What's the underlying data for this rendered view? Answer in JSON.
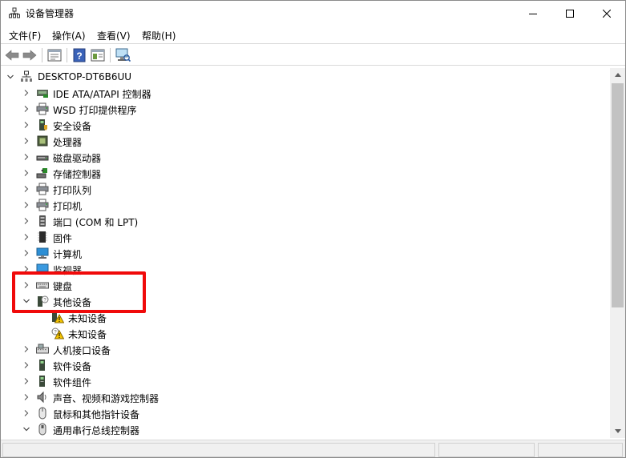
{
  "window": {
    "title": "设备管理器"
  },
  "menu": [
    {
      "label": "文件(F)"
    },
    {
      "label": "操作(A)"
    },
    {
      "label": "查看(V)"
    },
    {
      "label": "帮助(H)"
    }
  ],
  "toolbar": {
    "buttons": [
      {
        "icon": "back-arrow-icon"
      },
      {
        "icon": "forward-arrow-icon"
      },
      {
        "icon": "properties-icon"
      },
      {
        "icon": "help-icon"
      },
      {
        "icon": "view-icon"
      },
      {
        "icon": "scan-hardware-icon"
      }
    ]
  },
  "tree": {
    "root": {
      "label": "DESKTOP-DT6B6UU",
      "expanded": true
    },
    "items": [
      {
        "label": "IDE ATA/ATAPI 控制器",
        "icon": "ide-controller-icon",
        "expanded": false,
        "children": []
      },
      {
        "label": "WSD 打印提供程序",
        "icon": "printer-icon",
        "expanded": false,
        "children": []
      },
      {
        "label": "安全设备",
        "icon": "security-device-icon",
        "expanded": false,
        "children": []
      },
      {
        "label": "处理器",
        "icon": "processor-icon",
        "expanded": false,
        "children": []
      },
      {
        "label": "磁盘驱动器",
        "icon": "disk-drive-icon",
        "expanded": false,
        "children": []
      },
      {
        "label": "存储控制器",
        "icon": "storage-controller-icon",
        "expanded": false,
        "children": []
      },
      {
        "label": "打印队列",
        "icon": "print-queue-icon",
        "expanded": false,
        "children": []
      },
      {
        "label": "打印机",
        "icon": "printer-icon",
        "expanded": false,
        "children": []
      },
      {
        "label": "端口 (COM 和 LPT)",
        "icon": "port-icon",
        "expanded": false,
        "children": []
      },
      {
        "label": "固件",
        "icon": "firmware-icon",
        "expanded": false,
        "children": []
      },
      {
        "label": "计算机",
        "icon": "computer-icon",
        "expanded": false,
        "children": []
      },
      {
        "label": "监视器",
        "icon": "monitor-icon",
        "expanded": false,
        "children": []
      },
      {
        "label": "键盘",
        "icon": "keyboard-icon",
        "expanded": false,
        "children": []
      },
      {
        "label": "其他设备",
        "icon": "other-devices-icon",
        "expanded": true,
        "children": [
          {
            "label": "未知设备",
            "icon": "unknown-device-warning-icon"
          },
          {
            "label": "未知设备",
            "icon": "unknown-device-warning-icon"
          }
        ]
      },
      {
        "label": "人机接口设备",
        "icon": "hid-icon",
        "expanded": false,
        "children": []
      },
      {
        "label": "软件设备",
        "icon": "software-device-icon",
        "expanded": false,
        "children": []
      },
      {
        "label": "软件组件",
        "icon": "software-component-icon",
        "expanded": false,
        "children": []
      },
      {
        "label": "声音、视频和游戏控制器",
        "icon": "sound-icon",
        "expanded": false,
        "children": []
      },
      {
        "label": "鼠标和其他指针设备",
        "icon": "mouse-icon",
        "expanded": false,
        "children": []
      },
      {
        "label": "通用串行总线控制器",
        "icon": "usb-controller-icon",
        "expanded": true,
        "children": []
      }
    ]
  },
  "colors": {
    "highlight": "#f00a0a",
    "scroll_thumb": "#c2c2c2"
  }
}
